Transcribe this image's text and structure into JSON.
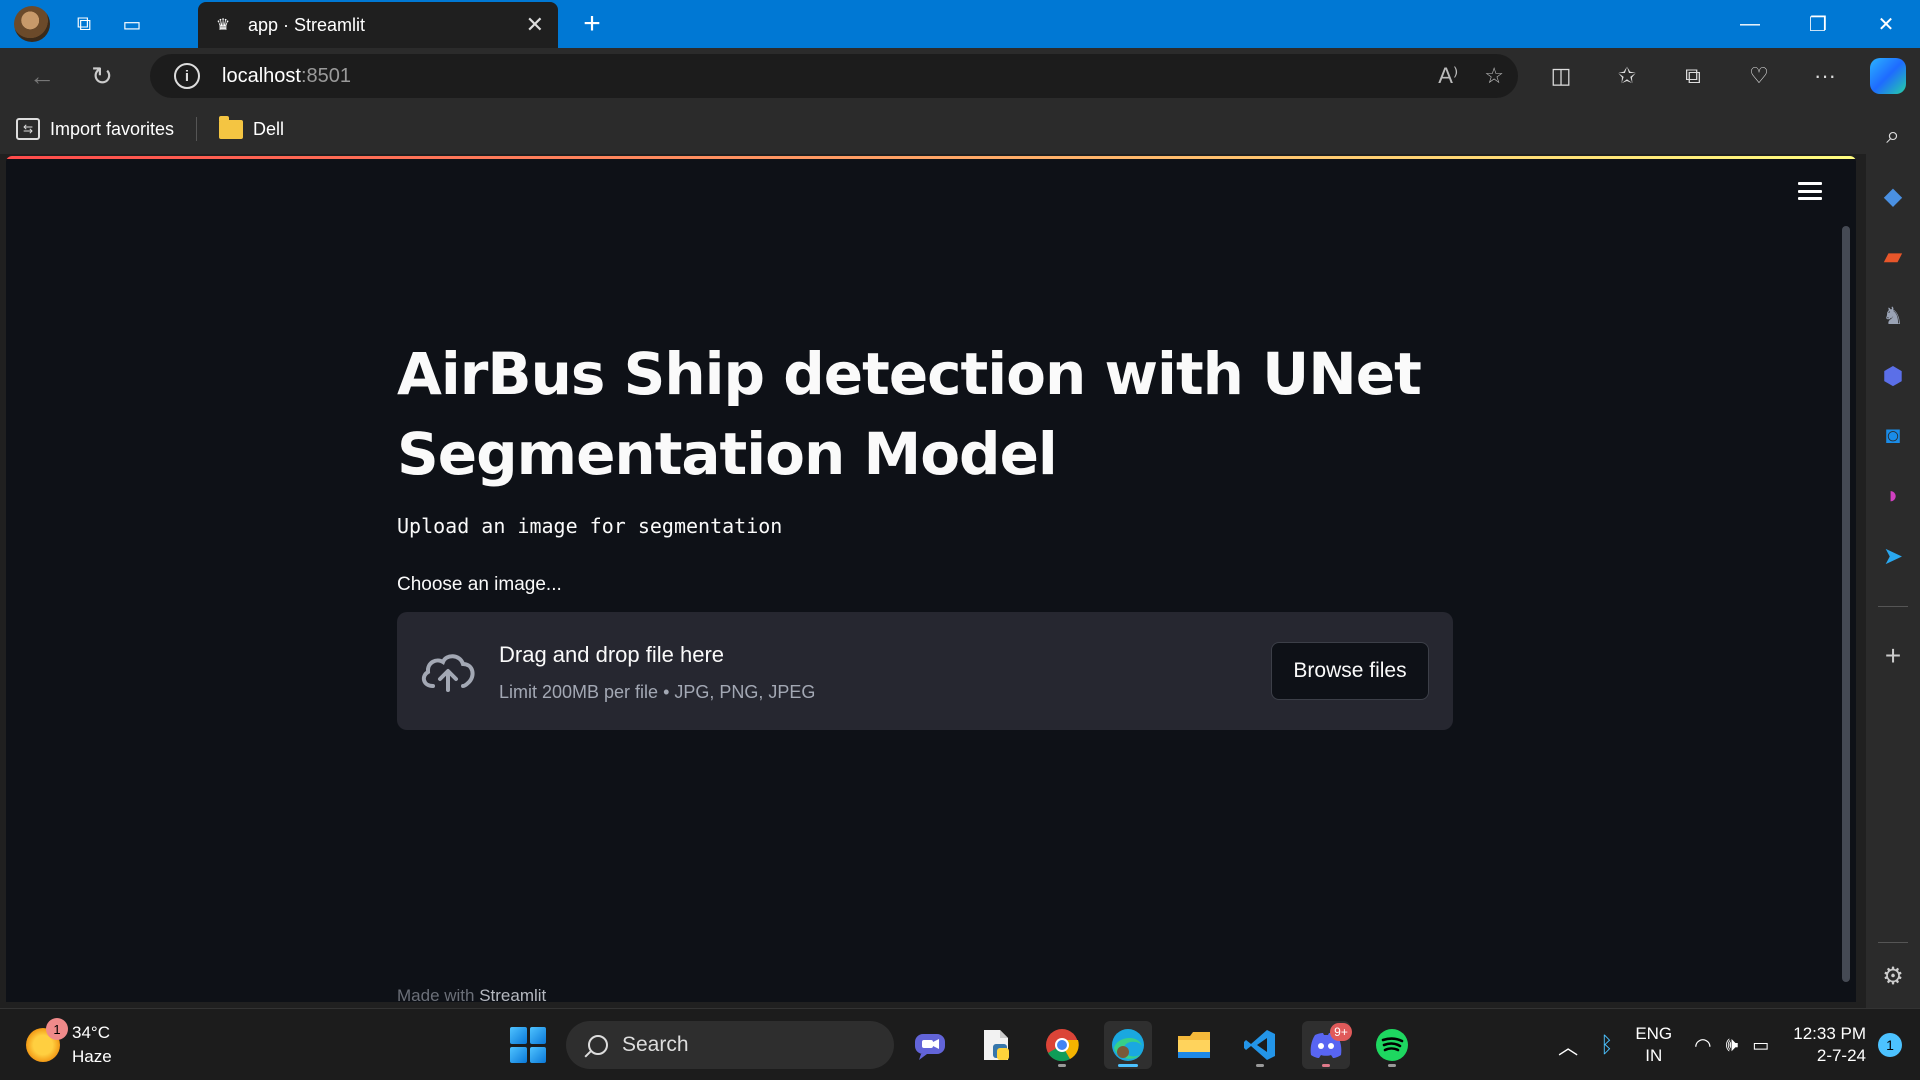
{
  "browser": {
    "tab_title": "app · Streamlit",
    "url_host": "localhost",
    "url_port": ":8501"
  },
  "favorites": [
    {
      "label": "Import favorites",
      "icon": "import-icon"
    },
    {
      "label": "Dell",
      "icon": "folder-icon"
    }
  ],
  "app": {
    "title": "AirBus Ship detection with UNet Segmentation Model",
    "subtitle": "Upload an image for segmentation",
    "uploader_label": "Choose an image...",
    "dropzone_title": "Drag and drop file here",
    "dropzone_limit": "Limit 200MB per file • JPG, PNG, JPEG",
    "browse_button": "Browse files",
    "footer_prefix": "Made with ",
    "footer_brand": "Streamlit"
  },
  "taskbar": {
    "temperature": "34°C",
    "condition": "Haze",
    "weather_badge": "1",
    "search_placeholder": "Search",
    "discord_badge": "9+",
    "language": "ENG",
    "region": "IN",
    "time": "12:33 PM",
    "date": "2-7-24",
    "notification_count": "1"
  },
  "colors": {
    "browser_accent": "#0078d4",
    "streamlit_bg": "#0e1117",
    "dropzone_bg": "#262730",
    "gradient_start": "#ff4b4b",
    "gradient_end": "#fffd80"
  }
}
